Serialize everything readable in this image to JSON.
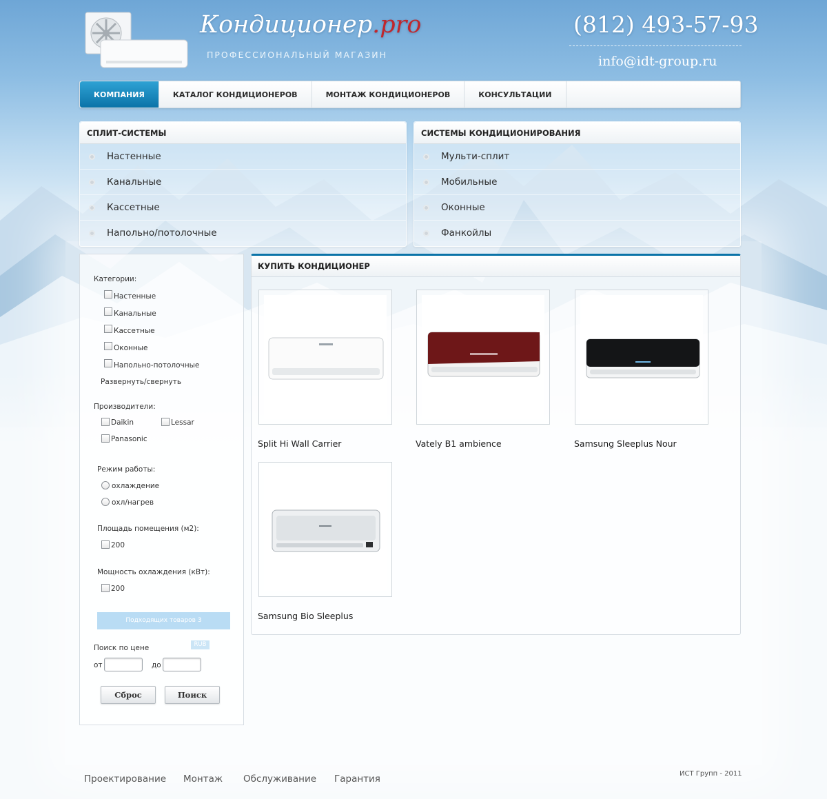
{
  "header": {
    "brand_main": "Кондиционер",
    "brand_suffix": ".pro",
    "tagline": "ПРОФЕССИОНАЛЬНЫЙ МАГАЗИН",
    "phone": "(812) 493-57-93",
    "email": "info@idt-group.ru"
  },
  "nav": {
    "items": [
      {
        "label": "КОМПАНИЯ",
        "active": true
      },
      {
        "label": "КАТАЛОГ КОНДИЦИОНЕРОВ"
      },
      {
        "label": "МОНТАЖ КОНДИЦИОНЕРОВ"
      },
      {
        "label": "КОНСУЛЬТАЦИИ"
      }
    ]
  },
  "split_systems": {
    "title": "СПЛИТ-СИСТЕМЫ",
    "items": [
      "Настенные",
      "Канальные",
      "Кассетные",
      "Напольно/потолочные"
    ]
  },
  "ac_systems": {
    "title": "СИСТЕМЫ КОНДИЦИОНИРОВАНИЯ",
    "items": [
      "Мульти-сплит",
      "Мобильные",
      "Оконные",
      "Фанкойлы"
    ]
  },
  "filter": {
    "categories_label": "Категории:",
    "categories": [
      "Настенные",
      "Канальные",
      "Кассетные",
      "Оконные",
      "Напольно-потолочные"
    ],
    "toggle_label": "Развернуть/свернуть",
    "manufacturers_label": "Производители:",
    "manufacturers": [
      "Daikin",
      "Lessar",
      "Panasonic"
    ],
    "mode_label": "Режим работы:",
    "modes": [
      "охлаждение",
      "охл/нагрев"
    ],
    "area_label": "Площадь помещения (м2):",
    "area_option": "200",
    "power_label": "Мощность охлаждения (кВт):",
    "power_option": "200",
    "matching_count": "Подходящих товаров 3",
    "price_label": "Поиск по цене",
    "currency": "RUB",
    "from_label": "от",
    "to_label": "до",
    "from_value": "",
    "to_value": "",
    "reset_button": "Сброс",
    "search_button": "Поиск"
  },
  "products": {
    "title": "КУПИТЬ КОНДИЦИОНЕР",
    "items": [
      {
        "name": "Split Hi Wall Carrier"
      },
      {
        "name": "Vately B1 ambience"
      },
      {
        "name": "Samsung Sleeplus Nour"
      },
      {
        "name": "Samsung Bio Sleeplus"
      }
    ]
  },
  "footer": {
    "links": [
      "Проектирование",
      "Монтаж",
      "Обслуживание",
      "Гарантия"
    ],
    "copyright": "ИСТ Групп - 2011"
  },
  "colors": {
    "accent": "#0b73a8",
    "brand_suffix": "#c0272d",
    "sky": "#8dbde3"
  }
}
